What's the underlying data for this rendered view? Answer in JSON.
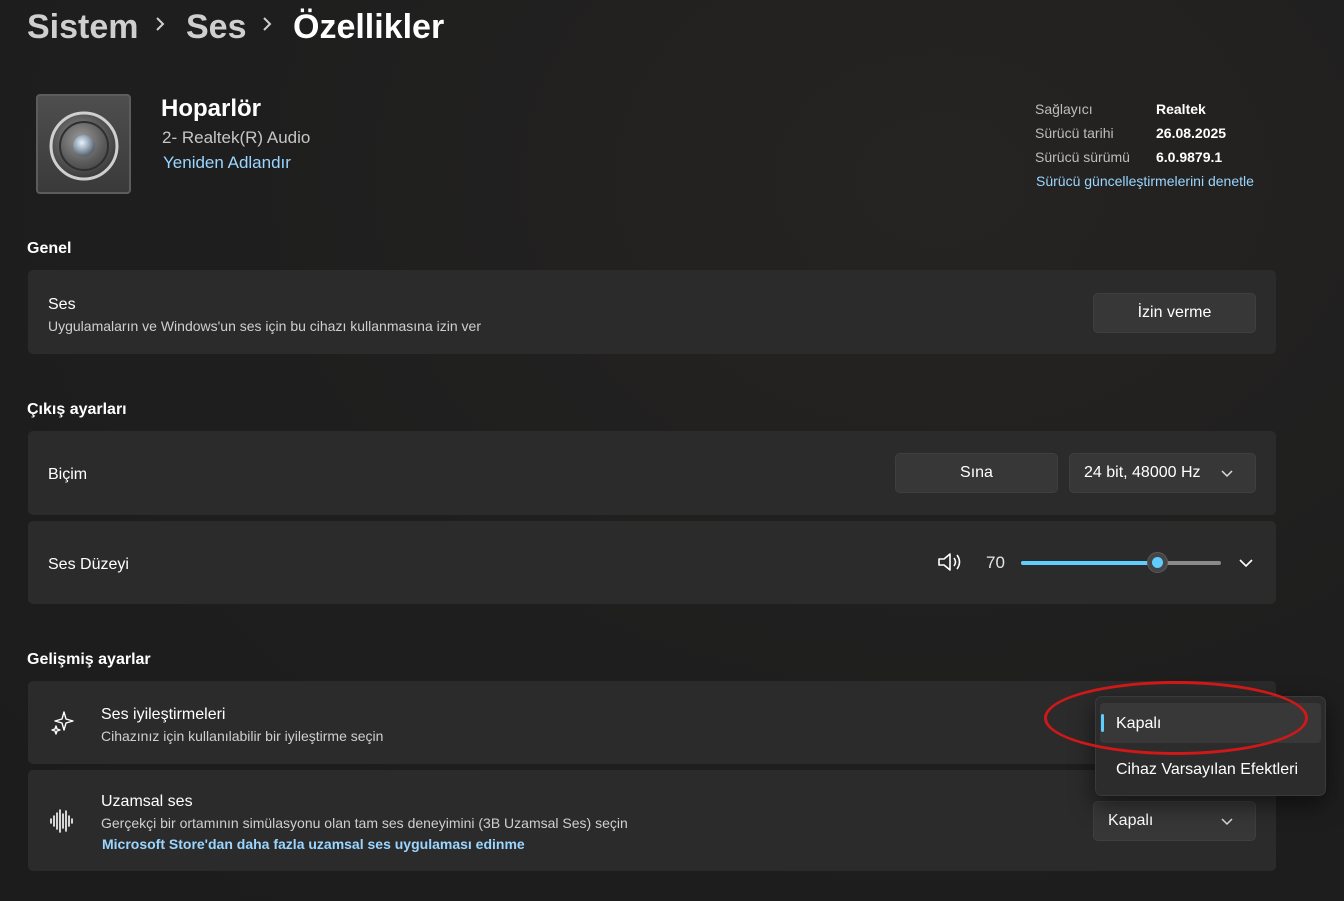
{
  "breadcrumb": {
    "items": [
      "Sistem",
      "Ses",
      "Özellikler"
    ]
  },
  "device": {
    "name": "Hoparlör",
    "subtitle": "2- Realtek(R) Audio",
    "rename_link": "Yeniden Adlandır",
    "icon": "speaker-icon"
  },
  "driver_info": {
    "provider_label": "Sağlayıcı",
    "provider_value": "Realtek",
    "date_label": "Sürücü tarihi",
    "date_value": "26.08.2025",
    "version_label": "Sürücü sürümü",
    "version_value": "6.0.9879.1",
    "update_link": "Sürücü güncelleştirmelerini denetle"
  },
  "general": {
    "title": "Genel",
    "audio": {
      "title": "Ses",
      "description": "Uygulamaların ve Windows'un ses için bu cihazı kullanmasına izin ver",
      "button_label": "İzin verme"
    }
  },
  "output": {
    "title": "Çıkış ayarları",
    "format": {
      "title": "Biçim",
      "test_button": "Sına",
      "selected_format": "24 bit, 48000 Hz"
    },
    "volume": {
      "title": "Ses Düzeyi",
      "value": "70",
      "level_percent": 68,
      "icon": "volume-icon"
    }
  },
  "advanced": {
    "title": "Gelişmiş ayarlar",
    "enhancements": {
      "title": "Ses iyileştirmeleri",
      "description": "Cihazınız için kullanılabilir bir iyileştirme seçin",
      "icon": "sparkle-icon"
    },
    "spatial": {
      "title": "Uzamsal ses",
      "description": "Gerçekçi bir ortamının simülasyonu olan tam ses deneyimini (3B Uzamsal Ses) seçin",
      "store_link": "Microsoft Store'dan daha fazla uzamsal ses uygulaması edinme",
      "selected": "Kapalı",
      "icon": "waveform-icon"
    }
  },
  "enhancement_menu": {
    "options": [
      "Kapalı",
      "Cihaz Varsayılan Efektleri"
    ],
    "selected_index": 0
  },
  "colors": {
    "accent": "#60cdff",
    "annotation": "#d11818",
    "background": "#1f1f1f",
    "card": "#2b2b2b"
  }
}
